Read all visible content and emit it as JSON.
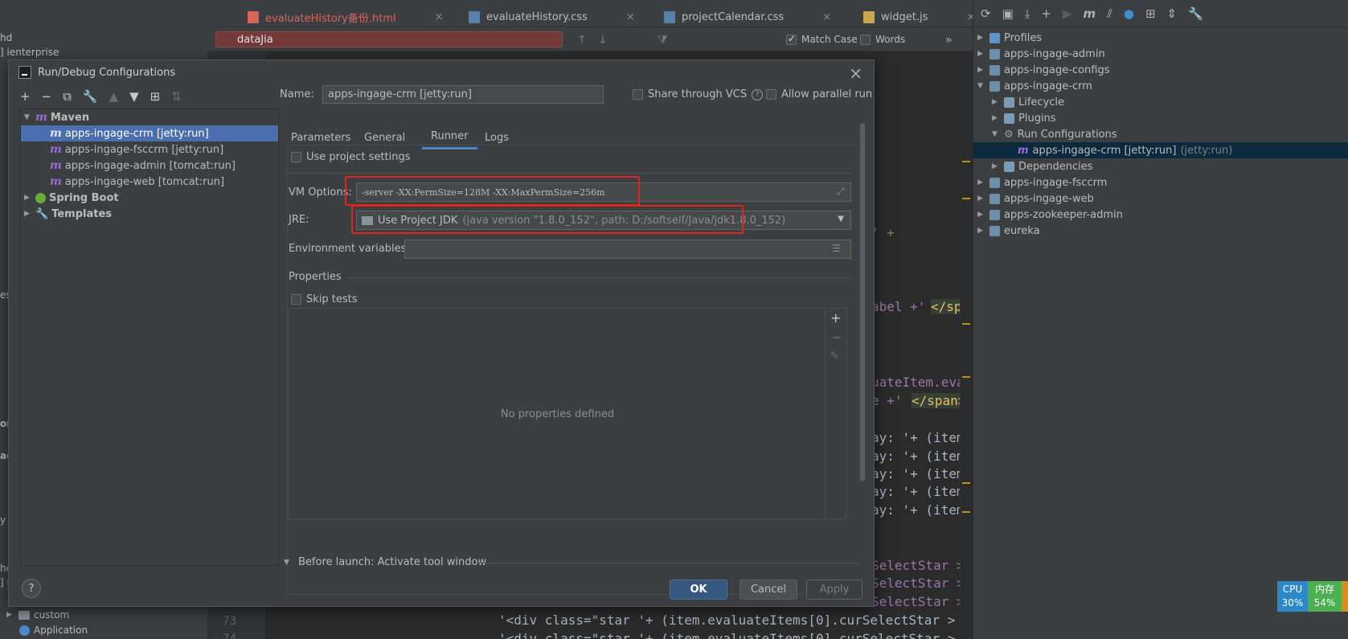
{
  "editor": {
    "tabs": [
      {
        "label": "evaluateHistory备份.html",
        "color": "#d9645a",
        "icon": "html-file-icon"
      },
      {
        "label": "evaluateHistory.css",
        "color": "#bbbbbb",
        "icon": "css-file-icon"
      },
      {
        "label": "projectCalendar.css",
        "color": "#bbbbbb",
        "icon": "css-file-icon"
      },
      {
        "label": "widget.js",
        "color": "#bbbbbb",
        "icon": "js-file-icon"
      }
    ],
    "close_glyph": "×",
    "search": {
      "value": "dataJia",
      "match_case_label": "Match Case",
      "words_label": "Words",
      "match_case_checked": true,
      "words_checked": false,
      "more_glyph": "»"
    },
    "line_numbers": [
      "73",
      "74"
    ],
    "code_fragments": [
      {
        "text": "' +"
      },
      {
        "text": "abel +'"
      },
      {
        "text": "</spa"
      },
      {
        "text": "uateItem.eva"
      },
      {
        "text": "e +'"
      },
      {
        "text": "</span>"
      },
      {
        "text": "ay: '+ (item"
      },
      {
        "text": "SelectStar >"
      },
      {
        "text": "'<div class=\"star '+ (item.evaluateItems[0].curSelectStar >"
      },
      {
        "text": "'<div class=\"star '+ (item.evaluateItems[0].curSelectStar >"
      }
    ]
  },
  "left_partial": {
    "texts": [
      "hd",
      "] ienterprise",
      "es",
      "orr",
      "ac",
      "y",
      "hc",
      "] i"
    ],
    "bottom_items": [
      {
        "label": "custom",
        "icon": "folder-icon"
      },
      {
        "label": "Application",
        "icon": "application-icon"
      }
    ]
  },
  "maven_panel": {
    "tree": [
      {
        "label": "Profiles",
        "level": 0,
        "icon": "folder-check-icon",
        "expanded": false
      },
      {
        "label": "apps-ingage-admin",
        "level": 0,
        "icon": "maven-module-icon",
        "expanded": false
      },
      {
        "label": "apps-ingage-configs",
        "level": 0,
        "icon": "maven-module-icon",
        "expanded": false
      },
      {
        "label": "apps-ingage-crm",
        "level": 0,
        "icon": "maven-module-icon",
        "expanded": true
      },
      {
        "label": "Lifecycle",
        "level": 1,
        "icon": "lifecycle-icon",
        "expanded": false
      },
      {
        "label": "Plugins",
        "level": 1,
        "icon": "plugins-icon",
        "expanded": false
      },
      {
        "label": "Run Configurations",
        "level": 1,
        "icon": "gear-icon",
        "expanded": true
      },
      {
        "label": "apps-ingage-crm [jetty:run]",
        "sub": "(jetty:run)",
        "level": 2,
        "icon": "maven-m-icon",
        "selected": true
      },
      {
        "label": "Dependencies",
        "level": 1,
        "icon": "dependencies-icon",
        "expanded": false
      },
      {
        "label": "apps-ingage-fsccrm",
        "level": 0,
        "icon": "maven-module-icon",
        "expanded": false
      },
      {
        "label": "apps-ingage-web",
        "level": 0,
        "icon": "maven-module-icon",
        "expanded": false
      },
      {
        "label": "apps-zookeeper-admin",
        "level": 0,
        "icon": "maven-module-icon",
        "expanded": false
      },
      {
        "label": "eureka",
        "level": 0,
        "icon": "maven-module-icon",
        "expanded": false
      }
    ]
  },
  "status_widget": {
    "cpu_label": "CPU",
    "cpu_value": "30%",
    "mem_label": "内存",
    "mem_value": "54%"
  },
  "dialog": {
    "title": "Run/Debug Configurations",
    "close_glyph": "×",
    "name_label": "Name:",
    "name_value": "apps-ingage-crm [jetty:run]",
    "share_vcs_label": "Share through VCS",
    "allow_parallel_label": "Allow parallel run",
    "tree": [
      {
        "label": "Maven",
        "level": 0,
        "icon": "maven-m-icon",
        "expanded": true,
        "bold": true
      },
      {
        "label": "apps-ingage-crm [jetty:run]",
        "level": 1,
        "icon": "maven-m-icon",
        "selected": true
      },
      {
        "label": "apps-ingage-fsccrm [jetty:run]",
        "level": 1,
        "icon": "maven-m-icon"
      },
      {
        "label": "apps-ingage-admin [tomcat:run]",
        "level": 1,
        "icon": "maven-m-icon"
      },
      {
        "label": "apps-ingage-web [tomcat:run]",
        "level": 1,
        "icon": "maven-m-icon"
      },
      {
        "label": "Spring Boot",
        "level": 0,
        "icon": "spring-boot-icon",
        "expanded": false,
        "bold": true
      },
      {
        "label": "Templates",
        "level": 0,
        "icon": "wrench-icon",
        "expanded": false,
        "bold": true
      }
    ],
    "tabs": [
      {
        "label": "Parameters",
        "active": false
      },
      {
        "label": "General",
        "active": false
      },
      {
        "label": "Runner",
        "active": true
      },
      {
        "label": "Logs",
        "active": false
      }
    ],
    "runner": {
      "use_project_settings_label": "Use project settings",
      "vm_options_label": "VM Options:",
      "vm_options_value": "-server -XX:PermSize=128M -XX:MaxPermSize=256m",
      "jre_label": "JRE:",
      "jre_value": "Use Project JDK",
      "jre_detail": "(java version \"1.8.0_152\", path: D:/softself/Java/jdk1.8.0_152)",
      "env_vars_label": "Environment variables:",
      "env_vars_value": "",
      "properties_label": "Properties",
      "skip_tests_label": "Skip tests",
      "no_properties_text": "No properties defined"
    },
    "before_launch_label": "Before launch: Activate tool window",
    "buttons": {
      "ok": "OK",
      "cancel": "Cancel",
      "apply": "Apply"
    },
    "help_glyph": "?",
    "annotation_color": "#e0241a"
  }
}
